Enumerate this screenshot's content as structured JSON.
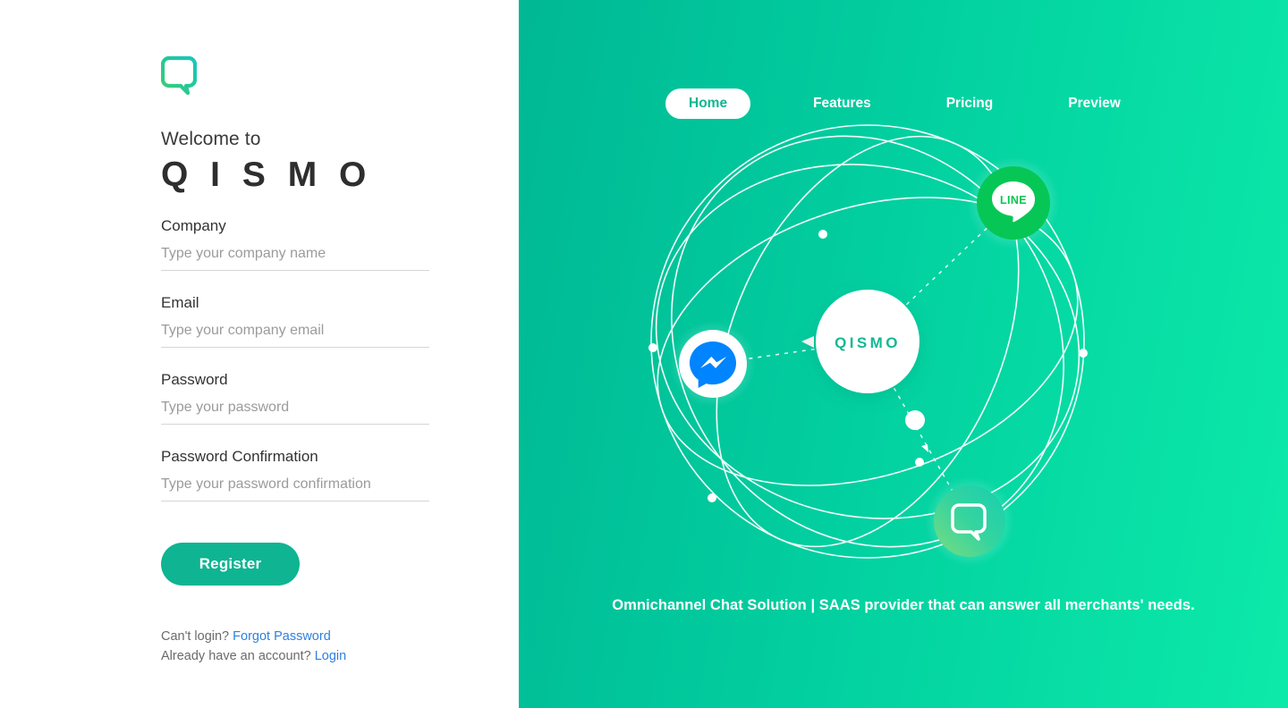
{
  "brand": {
    "logo_icon": "qismo-speech-bubble-logo",
    "welcome_text": "Welcome to",
    "name": "Q I S M O",
    "accent_color": "#0fb492",
    "link_color": "#2f7fe0"
  },
  "form": {
    "fields": [
      {
        "label": "Company",
        "placeholder": "Type your company name",
        "value": "",
        "type": "text"
      },
      {
        "label": "Email",
        "placeholder": "Type your company email",
        "value": "",
        "type": "text"
      },
      {
        "label": "Password",
        "placeholder": "Type your password",
        "value": "",
        "type": "password"
      },
      {
        "label": "Password Confirmation",
        "placeholder": "Type your password confirmation",
        "value": "",
        "type": "password"
      }
    ],
    "submit_label": "Register"
  },
  "footer": {
    "cant_login_text": "Can't login?",
    "forgot_password_link": "Forgot Password",
    "have_account_text": "Already have an account?",
    "login_link": "Login"
  },
  "nav": {
    "items": [
      {
        "label": "Home",
        "active": true
      },
      {
        "label": "Features",
        "active": false
      },
      {
        "label": "Pricing",
        "active": false
      },
      {
        "label": "Preview",
        "active": false
      }
    ]
  },
  "hero": {
    "center_label": "QISMO",
    "tagline": "Omnichannel Chat Solution | SAAS provider that can answer all merchants' needs.",
    "background_gradient_from": "#00b894",
    "background_gradient_to": "#0ceaa9",
    "channels": [
      {
        "name": "LINE",
        "icon": "line-icon",
        "label": "LINE",
        "color": "#06c755"
      },
      {
        "name": "Messenger",
        "icon": "messenger-icon",
        "label": "",
        "color": "#0084ff"
      },
      {
        "name": "Qismo",
        "icon": "qismo-bubble-icon",
        "label": "",
        "color": "#3ad29f"
      }
    ]
  }
}
